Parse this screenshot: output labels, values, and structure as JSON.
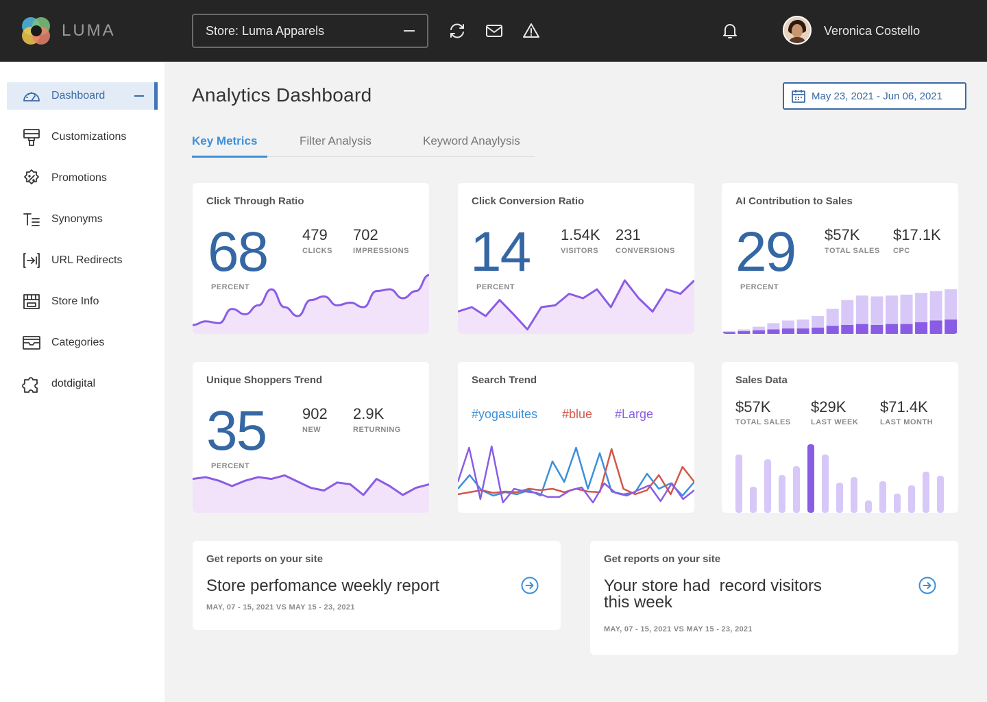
{
  "app": {
    "logo_text": "LUMA",
    "logo_icon": "luma-logo-icon"
  },
  "header": {
    "store_select": "Store: Luma Apparels",
    "icons": [
      "refresh-icon",
      "mail-icon",
      "warning-icon",
      "bell-icon"
    ],
    "user_name": "Veronica Costello"
  },
  "sidebar": {
    "items": [
      {
        "label": "Dashboard",
        "icon": "dashboard-icon",
        "active": true
      },
      {
        "label": "Customizations",
        "icon": "paint-roller-icon"
      },
      {
        "label": "Promotions",
        "icon": "promotion-badge-icon"
      },
      {
        "label": "Synonyms",
        "icon": "synonyms-icon"
      },
      {
        "label": "URL Redirects",
        "icon": "redirect-icon"
      },
      {
        "label": "Store Info",
        "icon": "store-icon"
      },
      {
        "label": "Categories",
        "icon": "categories-icon"
      },
      {
        "label": "dotdigital",
        "icon": "puzzle-icon"
      }
    ]
  },
  "main": {
    "title": "Analytics Dashboard",
    "date_range": "May 23, 2021 - Jun 06, 2021",
    "tabs": [
      {
        "label": "Key Metrics",
        "active": true
      },
      {
        "label": "Filter Analysis"
      },
      {
        "label": "Keyword Anaylysis"
      }
    ]
  },
  "cards": {
    "ctr": {
      "title": "Click Through Ratio",
      "value": "68",
      "unit": "PERCENT",
      "stats": [
        {
          "value": "479",
          "label": "CLICKS"
        },
        {
          "value": "702",
          "label": "IMPRESSIONS"
        }
      ]
    },
    "ccr": {
      "title": "Click Conversion Ratio",
      "value": "14",
      "unit": "PERCENT",
      "stats": [
        {
          "value": "1.54K",
          "label": "VISITORS"
        },
        {
          "value": "231",
          "label": "CONVERSIONS"
        }
      ]
    },
    "ai": {
      "title": "AI Contribution to Sales",
      "value": "29",
      "unit": "PERCENT",
      "stats": [
        {
          "value": "$57K",
          "label": "TOTAL SALES"
        },
        {
          "value": "$17.1K",
          "label": "CPC"
        }
      ]
    },
    "shoppers": {
      "title": "Unique Shoppers Trend",
      "value": "35",
      "unit": "PERCENT",
      "stats": [
        {
          "value": "902",
          "label": "NEW"
        },
        {
          "value": "2.9K",
          "label": "RETURNING"
        }
      ]
    },
    "search": {
      "title": "Search Trend",
      "tags": [
        {
          "label": "#yogasuites",
          "color": "#3d8fd9"
        },
        {
          "label": "#blue",
          "color": "#d2574a"
        },
        {
          "label": "#Large",
          "color": "#8a5ce6"
        }
      ]
    },
    "sales": {
      "title": "Sales Data",
      "stats": [
        {
          "value": "$57K",
          "label": "TOTAL SALES"
        },
        {
          "value": "$29K",
          "label": "LAST WEEK"
        },
        {
          "value": "$71.4K",
          "label": "LAST MONTH"
        }
      ]
    }
  },
  "reports": [
    {
      "subtitle": "Get reports on your site",
      "title": "Store perfomance weekly report",
      "date": "MAY, 07 - 15, 2021 VS MAY 15 - 23, 2021"
    },
    {
      "subtitle": "Get reports on your site",
      "title_line1": "Your store had  record visitors",
      "title_line2": "this week",
      "date": "MAY, 07 - 15, 2021 VS MAY 15 - 23, 2021"
    }
  ],
  "colors": {
    "accent": "#3d8fd9",
    "primary": "#3567a4",
    "purple": "#8a5ce6",
    "purple_light": "#d8c8f8",
    "area_fill": "#f2e3fa",
    "red": "#d2574a",
    "topbar": "#252525"
  },
  "chart_data": [
    {
      "type": "area",
      "name": "click-through-trend",
      "values": [
        10,
        14,
        12,
        28,
        22,
        32,
        50,
        30,
        20,
        38,
        42,
        32,
        35,
        30,
        48,
        50,
        40,
        48,
        66
      ]
    },
    {
      "type": "area",
      "name": "click-conversion-trend",
      "values": [
        25,
        30,
        20,
        38,
        22,
        5,
        30,
        32,
        45,
        40,
        50,
        30,
        60,
        40,
        25,
        50,
        45,
        60
      ]
    },
    {
      "type": "bar",
      "name": "ai-contribution",
      "series": [
        {
          "name": "total",
          "values": [
            3,
            5,
            8,
            12,
            15,
            16,
            20,
            28,
            38,
            43,
            42,
            43,
            44,
            46,
            48,
            50
          ]
        },
        {
          "name": "contribution",
          "values": [
            2,
            3,
            4,
            5,
            6,
            6,
            7,
            9,
            10,
            11,
            10,
            11,
            11,
            13,
            15,
            16
          ]
        }
      ]
    },
    {
      "type": "area",
      "name": "unique-shoppers-trend",
      "values": [
        38,
        40,
        36,
        30,
        36,
        40,
        38,
        42,
        35,
        28,
        25,
        34,
        32,
        20,
        38,
        30,
        20,
        28,
        32
      ]
    },
    {
      "type": "line",
      "name": "search-trend",
      "series": [
        {
          "name": "#yogasuites",
          "values": [
            30,
            50,
            28,
            20,
            25,
            22,
            28,
            20,
            70,
            40,
            90,
            30,
            82,
            26,
            22,
            25,
            52,
            30,
            38,
            20,
            40
          ]
        },
        {
          "name": "#blue",
          "values": [
            22,
            25,
            28,
            24,
            26,
            25,
            30,
            28,
            30,
            25,
            30,
            26,
            25,
            88,
            30,
            22,
            28,
            50,
            22,
            62,
            40
          ]
        },
        {
          "name": "#Large",
          "values": [
            40,
            90,
            15,
            92,
            10,
            30,
            26,
            24,
            18,
            18,
            28,
            32,
            10,
            38,
            24,
            20,
            28,
            35,
            12,
            38,
            15,
            28
          ]
        }
      ]
    },
    {
      "type": "bar",
      "name": "sales-data",
      "values": [
        85,
        38,
        78,
        55,
        68,
        100,
        85,
        44,
        52,
        18,
        46,
        28,
        40,
        60,
        54
      ],
      "highlight": 5
    }
  ]
}
